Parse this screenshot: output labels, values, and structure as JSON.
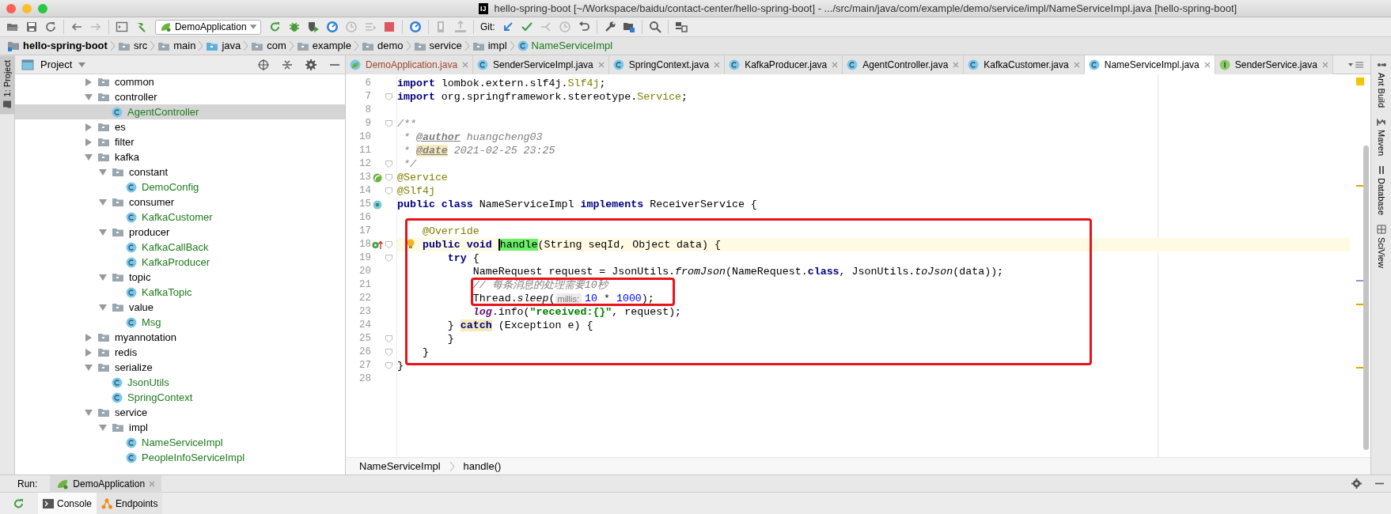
{
  "window": {
    "title": "hello-spring-boot [~/Workspace/baidu/contact-center/hello-spring-boot] - .../src/main/java/com/example/demo/service/impl/NameServiceImpl.java [hello-spring-boot]",
    "app_badge": "IJ"
  },
  "toolbar": [
    {
      "kind": "open",
      "disabled": false
    },
    {
      "kind": "save",
      "disabled": false
    },
    {
      "kind": "sync",
      "disabled": false
    },
    {
      "kind": "sep"
    },
    {
      "kind": "back",
      "disabled": false
    },
    {
      "kind": "forward",
      "disabled": true
    },
    {
      "kind": "sep"
    },
    {
      "kind": "window",
      "disabled": false
    },
    {
      "kind": "build",
      "disabled": false
    },
    {
      "kind": "run-config",
      "label": "DemoApplication",
      "disabled": false
    },
    {
      "kind": "rerun",
      "disabled": false
    },
    {
      "kind": "debug",
      "disabled": false
    },
    {
      "kind": "coverage",
      "disabled": false
    },
    {
      "kind": "profile",
      "disabled": false
    },
    {
      "kind": "attach",
      "disabled": true
    },
    {
      "kind": "step",
      "disabled": true
    },
    {
      "kind": "stop",
      "disabled": false
    },
    {
      "kind": "sep"
    },
    {
      "kind": "profile",
      "disabled": false
    },
    {
      "kind": "sep"
    },
    {
      "kind": "deploy",
      "disabled": true
    },
    {
      "kind": "upload",
      "disabled": true
    },
    {
      "kind": "sep"
    },
    {
      "kind": "label",
      "label": "Git:"
    },
    {
      "kind": "update",
      "disabled": false
    },
    {
      "kind": "commit",
      "disabled": false
    },
    {
      "kind": "merge",
      "disabled": true
    },
    {
      "kind": "history",
      "disabled": true
    },
    {
      "kind": "revert",
      "disabled": false
    },
    {
      "kind": "sep"
    },
    {
      "kind": "wrench",
      "disabled": false
    },
    {
      "kind": "structure",
      "disabled": false
    },
    {
      "kind": "sep"
    },
    {
      "kind": "search",
      "disabled": false
    },
    {
      "kind": "sep"
    },
    {
      "kind": "layout",
      "disabled": false
    }
  ],
  "breadcrumb": [
    {
      "kind": "module",
      "label": "hello-spring-boot"
    },
    {
      "kind": "folder",
      "label": "src"
    },
    {
      "kind": "folder",
      "label": "main"
    },
    {
      "kind": "source",
      "label": "java"
    },
    {
      "kind": "folder",
      "label": "com"
    },
    {
      "kind": "folder",
      "label": "example"
    },
    {
      "kind": "folder",
      "label": "demo"
    },
    {
      "kind": "folder",
      "label": "service"
    },
    {
      "kind": "folder",
      "label": "impl"
    },
    {
      "kind": "class",
      "label": "NameServiceImpl"
    }
  ],
  "left_strip": {
    "label": "1: Project",
    "selected": true
  },
  "project": {
    "title": "Project",
    "tree": [
      {
        "kind": "folder",
        "label": "common",
        "expanded": false,
        "selected": false
      },
      {
        "kind": "folder",
        "label": "controller",
        "expanded": true,
        "selected": false,
        "children": [
          {
            "kind": "class",
            "label": "AgentController",
            "selected": true
          }
        ]
      },
      {
        "kind": "folder",
        "label": "es",
        "expanded": false,
        "selected": false
      },
      {
        "kind": "folder",
        "label": "filter",
        "expanded": false,
        "selected": false
      },
      {
        "kind": "folder",
        "label": "kafka",
        "expanded": true,
        "selected": false,
        "children": [
          {
            "kind": "folder",
            "label": "constant",
            "expanded": true,
            "selected": false,
            "children": [
              {
                "kind": "class",
                "label": "DemoConfig",
                "selected": false
              }
            ]
          },
          {
            "kind": "folder",
            "label": "consumer",
            "expanded": true,
            "selected": false,
            "children": [
              {
                "kind": "class",
                "label": "KafkaCustomer",
                "selected": false
              }
            ]
          },
          {
            "kind": "folder",
            "label": "producer",
            "expanded": true,
            "selected": false,
            "children": [
              {
                "kind": "class",
                "label": "KafkaCallBack",
                "selected": false
              },
              {
                "kind": "class",
                "label": "KafkaProducer",
                "selected": false
              }
            ]
          },
          {
            "kind": "folder",
            "label": "topic",
            "expanded": true,
            "selected": false,
            "children": [
              {
                "kind": "class",
                "label": "KafkaTopic",
                "selected": false
              }
            ]
          },
          {
            "kind": "folder",
            "label": "value",
            "expanded": true,
            "selected": false,
            "children": [
              {
                "kind": "class",
                "label": "Msg",
                "selected": false
              }
            ]
          }
        ]
      },
      {
        "kind": "folder",
        "label": "myannotation",
        "expanded": false,
        "selected": false
      },
      {
        "kind": "folder",
        "label": "redis",
        "expanded": false,
        "selected": false
      },
      {
        "kind": "folder",
        "label": "serialize",
        "expanded": true,
        "selected": false,
        "children": [
          {
            "kind": "class",
            "label": "JsonUtils",
            "selected": false
          },
          {
            "kind": "class",
            "label": "SpringContext",
            "selected": false
          }
        ]
      },
      {
        "kind": "folder",
        "label": "service",
        "expanded": true,
        "selected": false,
        "children": [
          {
            "kind": "folder",
            "label": "impl",
            "expanded": true,
            "selected": false,
            "children": [
              {
                "kind": "class",
                "label": "NameServiceImpl",
                "selected": false
              },
              {
                "kind": "class",
                "label": "PeopleInfoServiceImpl",
                "selected": false
              }
            ]
          }
        ]
      }
    ]
  },
  "editor_tabs": [
    {
      "kind": "spring",
      "label": "DemoApplication.java",
      "selected": false,
      "color": "#a0452a"
    },
    {
      "kind": "class",
      "label": "SenderServiceImpl.java",
      "selected": false,
      "color": "#000000"
    },
    {
      "kind": "class",
      "label": "SpringContext.java",
      "selected": false,
      "color": "#000000"
    },
    {
      "kind": "class",
      "label": "KafkaProducer.java",
      "selected": false,
      "color": "#000000"
    },
    {
      "kind": "class",
      "label": "AgentController.java",
      "selected": false,
      "color": "#000000"
    },
    {
      "kind": "class",
      "label": "KafkaCustomer.java",
      "selected": false,
      "color": "#000000"
    },
    {
      "kind": "class",
      "label": "NameServiceImpl.java",
      "selected": true,
      "color": "#000000"
    },
    {
      "kind": "interface",
      "label": "SenderService.java",
      "selected": false,
      "color": "#000000"
    }
  ],
  "code": [
    {
      "number": "6",
      "fold": false,
      "current": false,
      "in_large_box": false,
      "in_small_box": false,
      "tokens": [
        {
          "kind": "kw",
          "text": "import"
        },
        {
          "kind": "t",
          "text": " lombok.extern.slf4j."
        },
        {
          "kind": "ann",
          "text": "Slf4j"
        },
        {
          "kind": "t",
          "text": ";"
        }
      ]
    },
    {
      "number": "7",
      "fold": true,
      "current": false,
      "in_large_box": false,
      "in_small_box": false,
      "tokens": [
        {
          "kind": "kw",
          "text": "import"
        },
        {
          "kind": "t",
          "text": " org.springframework.stereotype."
        },
        {
          "kind": "ann",
          "text": "Service"
        },
        {
          "kind": "t",
          "text": ";"
        }
      ]
    },
    {
      "number": "8",
      "fold": false,
      "current": false,
      "in_large_box": false,
      "in_small_box": false
    },
    {
      "number": "9",
      "fold": true,
      "current": false,
      "in_large_box": false,
      "in_small_box": false,
      "tokens": [
        {
          "kind": "cmt",
          "text": "/**"
        }
      ]
    },
    {
      "number": "10",
      "fold": false,
      "current": false,
      "in_large_box": false,
      "in_small_box": false,
      "tokens": [
        {
          "kind": "cmt",
          "text": " * "
        },
        {
          "kind": "tag",
          "text": "@author"
        },
        {
          "kind": "cmt",
          "text": " huangcheng03"
        }
      ]
    },
    {
      "number": "11",
      "fold": false,
      "current": false,
      "in_large_box": false,
      "in_small_box": false,
      "tokens": [
        {
          "kind": "cmt",
          "text": " * "
        },
        {
          "kind": "taghl",
          "text": "@date"
        },
        {
          "kind": "cmt",
          "text": " 2021-02-25 23:25"
        }
      ]
    },
    {
      "number": "12",
      "fold": true,
      "current": false,
      "in_large_box": false,
      "in_small_box": false,
      "tokens": [
        {
          "kind": "cmt",
          "text": " */"
        }
      ]
    },
    {
      "number": "13",
      "fold": true,
      "current": false,
      "kind": "bean",
      "in_large_box": false,
      "in_small_box": false,
      "tokens": [
        {
          "kind": "ann",
          "text": "@Service"
        }
      ]
    },
    {
      "number": "14",
      "fold": true,
      "current": false,
      "in_large_box": false,
      "in_small_box": false,
      "tokens": [
        {
          "kind": "ann",
          "text": "@Slf4j"
        }
      ]
    },
    {
      "number": "15",
      "fold": false,
      "current": false,
      "kind": "class",
      "in_large_box": false,
      "in_small_box": false,
      "tokens": [
        {
          "kind": "kw",
          "text": "public class"
        },
        {
          "kind": "t",
          "text": " NameServiceImpl "
        },
        {
          "kind": "kw",
          "text": "implements"
        },
        {
          "kind": "t",
          "text": " ReceiverService {"
        }
      ]
    },
    {
      "number": "16",
      "fold": false,
      "current": false,
      "in_large_box": false,
      "in_small_box": false
    },
    {
      "number": "17",
      "fold": false,
      "current": false,
      "in_large_box": true,
      "in_small_box": false,
      "tokens": [
        {
          "kind": "ann",
          "text": "    @Override"
        }
      ]
    },
    {
      "number": "18",
      "fold": true,
      "current": true,
      "kind": "override",
      "bulb": true,
      "in_large_box": true,
      "in_small_box": false,
      "tokens": [
        {
          "kind": "kw",
          "text": "    public void "
        },
        {
          "kind": "match",
          "text": "handle"
        },
        {
          "kind": "t",
          "text": "(String seqId, Object data) {"
        }
      ]
    },
    {
      "number": "19",
      "fold": true,
      "current": false,
      "in_large_box": true,
      "in_small_box": false,
      "tokens": [
        {
          "kind": "kw",
          "text": "        try"
        },
        {
          "kind": "t",
          "text": " {"
        }
      ]
    },
    {
      "number": "20",
      "fold": false,
      "current": false,
      "in_large_box": true,
      "in_small_box": false,
      "tokens": [
        {
          "kind": "t",
          "text": "            NameRequest request = JsonUtils."
        },
        {
          "kind": "it",
          "text": "fromJson"
        },
        {
          "kind": "t",
          "text": "(NameRequest."
        },
        {
          "kind": "kw",
          "text": "class"
        },
        {
          "kind": "t",
          "text": ", JsonUtils."
        },
        {
          "kind": "it",
          "text": "toJson"
        },
        {
          "kind": "t",
          "text": "(data));"
        }
      ]
    },
    {
      "number": "21",
      "fold": false,
      "current": false,
      "in_large_box": true,
      "in_small_box": true,
      "tokens": [
        {
          "kind": "cmt",
          "text": "            // 每条消息的处理需要10秒"
        }
      ]
    },
    {
      "number": "22",
      "fold": false,
      "current": false,
      "in_large_box": true,
      "in_small_box": true,
      "tokens": [
        {
          "kind": "t",
          "text": "            Thread."
        },
        {
          "kind": "it",
          "text": "sleep"
        },
        {
          "kind": "t",
          "text": "("
        },
        {
          "kind": "hint",
          "text": "millis:"
        },
        {
          "kind": "num",
          "text": "10"
        },
        {
          "kind": "t",
          "text": " * "
        },
        {
          "kind": "num",
          "text": "1000"
        },
        {
          "kind": "t",
          "text": ");"
        }
      ]
    },
    {
      "number": "23",
      "fold": false,
      "current": false,
      "in_large_box": true,
      "in_small_box": false,
      "tokens": [
        {
          "kind": "static",
          "text": "            log"
        },
        {
          "kind": "t",
          "text": ".info("
        },
        {
          "kind": "str",
          "text": "\"received:{}\""
        },
        {
          "kind": "t",
          "text": ", request);"
        }
      ]
    },
    {
      "number": "24",
      "fold": false,
      "current": false,
      "in_large_box": true,
      "in_small_box": false,
      "tokens": [
        {
          "kind": "t",
          "text": "        } "
        },
        {
          "kind": "kwhl",
          "text": "catch"
        },
        {
          "kind": "t",
          "text": " (Exception e) {"
        }
      ]
    },
    {
      "number": "25",
      "fold": true,
      "current": false,
      "in_large_box": true,
      "in_small_box": false,
      "tokens": [
        {
          "kind": "t",
          "text": "        }"
        }
      ]
    },
    {
      "number": "26",
      "fold": true,
      "current": false,
      "in_large_box": true,
      "in_small_box": false,
      "tokens": [
        {
          "kind": "t",
          "text": "    }"
        }
      ]
    },
    {
      "number": "27",
      "fold": true,
      "current": false,
      "in_large_box": false,
      "in_small_box": false,
      "tokens": [
        {
          "kind": "t",
          "text": "}"
        }
      ]
    },
    {
      "number": "28",
      "fold": false,
      "current": false,
      "in_large_box": false,
      "in_small_box": false
    }
  ],
  "editor_breadcrumb": [
    "NameServiceImpl",
    "handle()"
  ],
  "right_strip": [
    {
      "kind": "ant",
      "label": "Ant Build"
    },
    {
      "kind": "maven",
      "label": "Maven"
    },
    {
      "kind": "database",
      "label": "Database"
    },
    {
      "kind": "sciview",
      "label": "SciView"
    }
  ],
  "run_bar": {
    "title": "Run:",
    "tabs": [
      {
        "label": "DemoApplication",
        "selected": true
      }
    ]
  },
  "console_tabs": [
    {
      "kind": "console",
      "label": "Console",
      "selected": true
    },
    {
      "kind": "endpoints",
      "label": "Endpoints",
      "selected": false
    }
  ]
}
